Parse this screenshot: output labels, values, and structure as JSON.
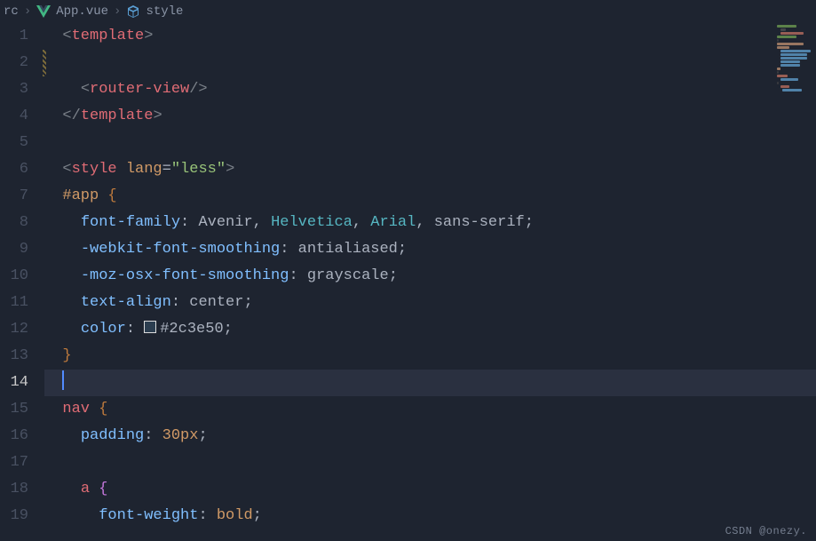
{
  "breadcrumb": {
    "root": "rc",
    "file": "App.vue",
    "symbol": "style"
  },
  "editor": {
    "active_line": 14,
    "lines": [
      {
        "n": 1
      },
      {
        "n": 2
      },
      {
        "n": 3
      },
      {
        "n": 4
      },
      {
        "n": 5
      },
      {
        "n": 6
      },
      {
        "n": 7
      },
      {
        "n": 8
      },
      {
        "n": 9
      },
      {
        "n": 10
      },
      {
        "n": 11
      },
      {
        "n": 12
      },
      {
        "n": 13
      },
      {
        "n": 14
      },
      {
        "n": 15
      },
      {
        "n": 16
      },
      {
        "n": 17
      },
      {
        "n": 18
      },
      {
        "n": 19
      }
    ],
    "tokens": {
      "l1": {
        "template": "template"
      },
      "l3": {
        "router_view": "router-view"
      },
      "l4": {
        "template": "template"
      },
      "l6": {
        "style": "style",
        "lang": "lang",
        "less": "\"less\""
      },
      "l7": {
        "sel": "#app"
      },
      "l8": {
        "p": "font-family",
        "v1": "Avenir",
        "v2": "Helvetica",
        "v3": "Arial",
        "v4": "sans-serif"
      },
      "l9": {
        "p": "-webkit-font-smoothing",
        "v": "antialiased"
      },
      "l10": {
        "p": "-moz-osx-font-smoothing",
        "v": "grayscale"
      },
      "l11": {
        "p": "text-align",
        "v": "center"
      },
      "l12": {
        "p": "color",
        "v": "#2c3e50"
      },
      "l15": {
        "sel": "nav"
      },
      "l16": {
        "p": "padding",
        "v": "30px"
      },
      "l18": {
        "sel": "a"
      },
      "l19": {
        "p": "font-weight",
        "v": "bold"
      }
    }
  },
  "watermark": "CSDN @onezy."
}
